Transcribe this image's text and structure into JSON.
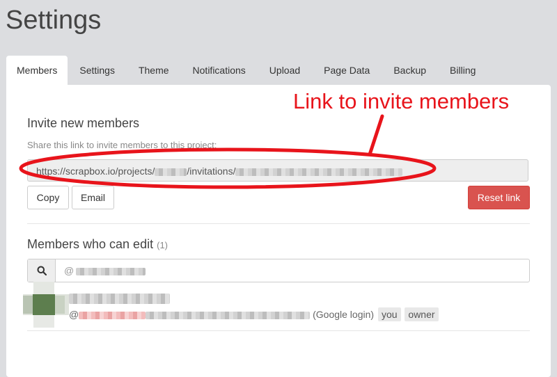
{
  "page": {
    "title": "Settings"
  },
  "tabs": [
    {
      "label": "Members"
    },
    {
      "label": "Settings"
    },
    {
      "label": "Theme"
    },
    {
      "label": "Notifications"
    },
    {
      "label": "Upload"
    },
    {
      "label": "Page Data"
    },
    {
      "label": "Backup"
    },
    {
      "label": "Billing"
    }
  ],
  "invite": {
    "title": "Invite new members",
    "hint": "Share this link to invite members to this project:",
    "link_prefix": "https://scrapbox.io/projects/",
    "link_mid": "/invitations/",
    "copy_label": "Copy",
    "email_label": "Email",
    "reset_label": "Reset link"
  },
  "members": {
    "title": "Members who can edit",
    "count": "(1)",
    "search_prefix": "@",
    "list": [
      {
        "handle_prefix": "@",
        "login": "(Google login)",
        "tags": [
          "you",
          "owner"
        ]
      }
    ]
  },
  "annotation": {
    "text": "Link to invite members",
    "color": "#e8141b"
  },
  "icons": {
    "search": "search-icon"
  }
}
